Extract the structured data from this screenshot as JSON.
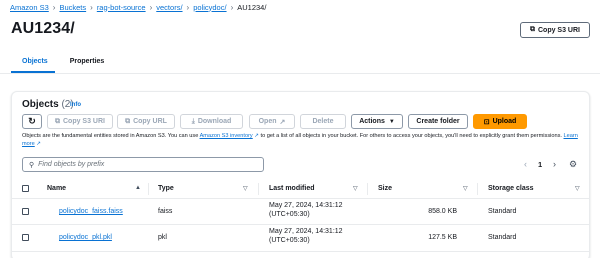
{
  "breadcrumb": {
    "items": [
      "Amazon S3",
      "Buckets",
      "rag-bot-source",
      "vectors/",
      "policydoc/"
    ],
    "current": "AU1234/"
  },
  "header": {
    "title": "AU1234/",
    "copy_uri_label": "Copy S3 URI"
  },
  "tabs": [
    {
      "label": "Objects",
      "active": true
    },
    {
      "label": "Properties",
      "active": false
    }
  ],
  "objects_panel": {
    "heading": "Objects",
    "count": "(2)",
    "info_label": "Info",
    "toolbar": {
      "refresh_icon": "refresh-icon",
      "copy_s3_uri": "Copy S3 URI",
      "copy_url": "Copy URL",
      "download": "Download",
      "open": "Open",
      "delete": "Delete",
      "actions": "Actions",
      "create_folder": "Create folder",
      "upload": "Upload"
    },
    "description_prefix": "Objects are the fundamental entities stored in Amazon S3. You can use ",
    "inventory_link": "Amazon S3 inventory",
    "description_middle": " to get a list of all objects in your bucket. For others to access your objects, you'll need to explicitly grant them permissions. ",
    "learn_more": "Learn more",
    "search_placeholder": "Find objects by prefix",
    "pagination": {
      "current_page": "1"
    }
  },
  "table": {
    "columns": [
      "Name",
      "Type",
      "Last modified",
      "Size",
      "Storage class"
    ],
    "rows": [
      {
        "name": "policydoc_faiss.faiss",
        "type": "faiss",
        "modified_line1": "May 27, 2024, 14:31:12",
        "modified_line2": "(UTC+05:30)",
        "size": "858.0 KB",
        "storage": "Standard"
      },
      {
        "name": "policydoc_pkl.pkl",
        "type": "pkl",
        "modified_line1": "May 27, 2024, 14:31:12",
        "modified_line2": "(UTC+05:30)",
        "size": "127.5 KB",
        "storage": "Standard"
      }
    ]
  },
  "colors": {
    "accent": "#0972d3",
    "upload": "#ff9900",
    "text": "#16191f",
    "muted": "#5f6b7a"
  }
}
